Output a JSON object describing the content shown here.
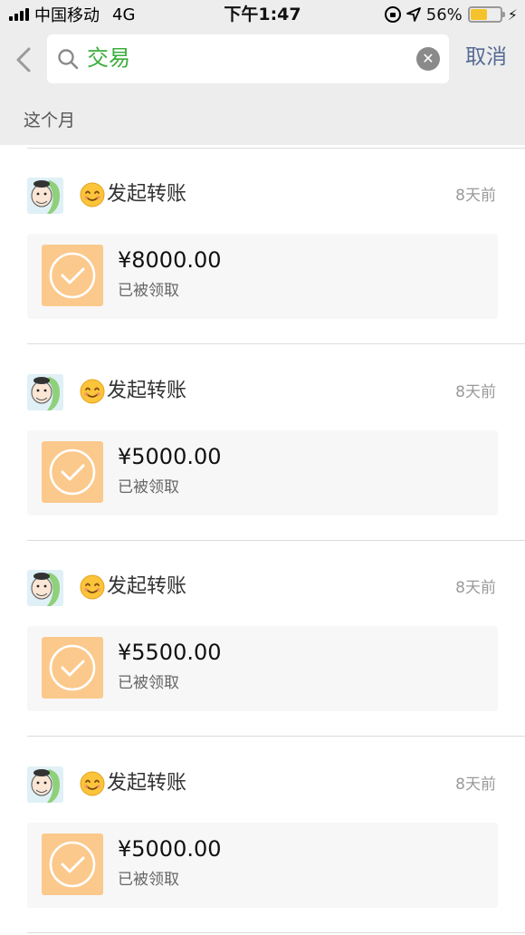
{
  "status_bar": {
    "carrier": "中国移动",
    "network": "4G",
    "time": "下午1:47",
    "battery_percent": "56%",
    "battery_level": 0.56,
    "battery_color": "#f5c22c"
  },
  "search": {
    "query": "交易",
    "cancel_label": "取消"
  },
  "section": {
    "label": "这个月"
  },
  "colors": {
    "query_green": "#3cae3c",
    "link_blue": "#576b95",
    "card_icon_orange": "#fbc98c"
  },
  "transactions": [
    {
      "action": "发起转账",
      "time_ago": "8天前",
      "amount": "¥8000.00",
      "status": "已被领取"
    },
    {
      "action": "发起转账",
      "time_ago": "8天前",
      "amount": "¥5000.00",
      "status": "已被领取"
    },
    {
      "action": "发起转账",
      "time_ago": "8天前",
      "amount": "¥5500.00",
      "status": "已被领取"
    },
    {
      "action": "发起转账",
      "time_ago": "8天前",
      "amount": "¥5000.00",
      "status": "已被领取"
    }
  ],
  "icons": {
    "back": "chevron-left-icon",
    "search": "search-icon",
    "clear": "clear-icon",
    "emoji": "smile-emoji-icon",
    "card": "checkmark-circle-icon"
  }
}
